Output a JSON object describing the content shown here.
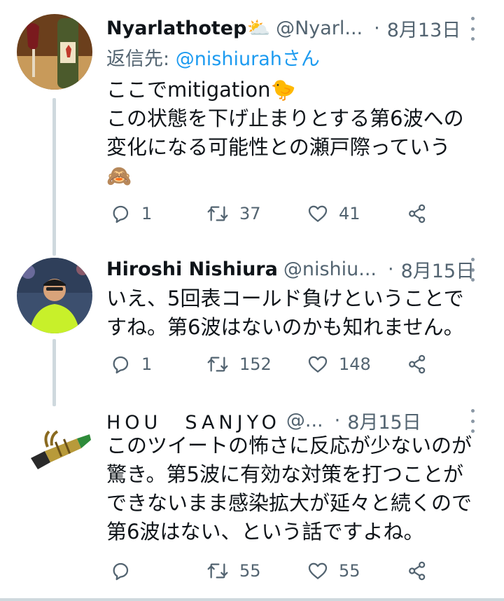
{
  "tweets": [
    {
      "name": "Nyarlathotep",
      "name_emoji": "⛅",
      "handle": "@Nyarl...",
      "dot": "·",
      "date": "8月13日",
      "replying_prefix": "返信先: ",
      "replying_mention": "@nishiurah",
      "replying_suffix": "さん",
      "lines": [
        "ここでmitigation🐤",
        "この状態を下げ止まりとする第6波への",
        "変化になる可能性との瀬戸際っていう",
        "🙈"
      ],
      "replies": "1",
      "retweets": "37",
      "likes": "41"
    },
    {
      "name": "Hiroshi Nishiura",
      "handle": "@nishiu...",
      "dot": "·",
      "date": "8月15日",
      "lines": [
        "いえ、5回表コールド負けということで",
        "すね。第6波はないのかも知れません。"
      ],
      "replies": "1",
      "retweets": "152",
      "likes": "148"
    },
    {
      "name": "HOU　SANJYO",
      "handle": "@...",
      "dot": "·",
      "date": "8月15日",
      "lines": [
        "このツイートの怖さに反応が少ないのが",
        "驚き。第5波に有効な対策を打つことが",
        "できないまま感染拡大が延々と続くので",
        "第6波はない、という話ですよね。"
      ],
      "replies": "",
      "retweets": "55",
      "likes": "55"
    }
  ],
  "icons": {
    "reply": "reply-icon",
    "retweet": "retweet-icon",
    "like": "heart-icon",
    "share": "share-icon",
    "more": "more-icon"
  },
  "colors": {
    "text": "#0f1419",
    "secondary": "#536471",
    "link": "#1d9bf0",
    "thread_line": "#cfd9de"
  }
}
